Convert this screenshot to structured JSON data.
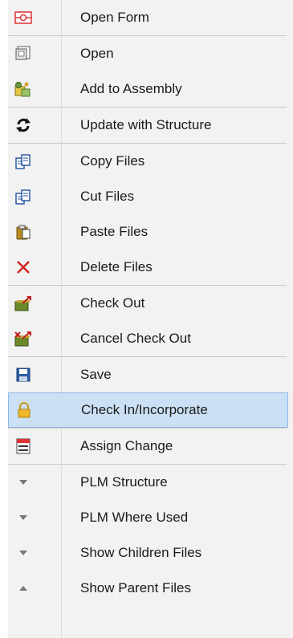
{
  "menu": {
    "items": [
      {
        "label": "Open Form",
        "icon": "open-form-icon"
      },
      {
        "label": "Open",
        "icon": "open-icon"
      },
      {
        "label": "Add to Assembly",
        "icon": "add-to-assembly-icon"
      },
      {
        "label": "Update with Structure",
        "icon": "update-icon"
      },
      {
        "label": "Copy Files",
        "icon": "copy-files-icon"
      },
      {
        "label": "Cut Files",
        "icon": "cut-files-icon"
      },
      {
        "label": "Paste Files",
        "icon": "paste-files-icon"
      },
      {
        "label": "Delete Files",
        "icon": "delete-icon"
      },
      {
        "label": "Check Out",
        "icon": "check-out-icon"
      },
      {
        "label": "Cancel Check Out",
        "icon": "cancel-check-out-icon"
      },
      {
        "label": "Save",
        "icon": "save-icon"
      },
      {
        "label": "Check In/Incorporate",
        "icon": "lock-icon"
      },
      {
        "label": "Assign Change",
        "icon": "calendar-icon"
      },
      {
        "label": "PLM Structure",
        "icon": "chevron-down-icon"
      },
      {
        "label": "PLM Where Used",
        "icon": "chevron-down-icon"
      },
      {
        "label": "Show Children Files",
        "icon": "chevron-down-icon"
      },
      {
        "label": "Show Parent Files",
        "icon": "chevron-up-icon"
      }
    ],
    "highlighted": "Check In/Incorporate"
  },
  "colors": {
    "menu_bg": "#f2f2f2",
    "highlight_bg": "#cce0f5",
    "highlight_border": "#8fb8e6",
    "delete_red": "#d22020"
  }
}
